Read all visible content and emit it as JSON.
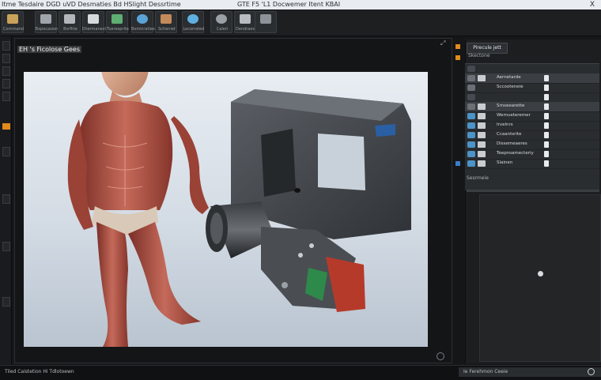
{
  "titlebar": {
    "text_left": "Itme Tesdaire DGD uVD Desmaties Bd HSlight Dessrtime",
    "text_right": "GTE F5 'L1 Docwemer Itent KBAI",
    "close": "X"
  },
  "toolbar": {
    "buttons": [
      {
        "label": "Cornmand",
        "color": "#c9a25a"
      },
      {
        "label": "Bxpocasion",
        "color": "#9fa5aa"
      },
      {
        "label": "Bsrfitie",
        "color": "#b2b7bb"
      },
      {
        "label": "Dhermanest",
        "color": "#5fae72"
      },
      {
        "label": "Tueresprite",
        "color": "#5aa3d6"
      },
      {
        "label": "Bxmicratiee",
        "color": "#c48a5a"
      },
      {
        "label": "Scheniet",
        "color": "#5fb0e0"
      },
      {
        "label": "Lecorrated",
        "color": "#9aa0a5"
      },
      {
        "label": "Caleri",
        "color": "#b8bcc0"
      },
      {
        "label": "Dendraest",
        "color": "#8d9398"
      }
    ]
  },
  "viewport": {
    "header": "EH 's Ficolose Gees",
    "corner_icon": "expand-icon"
  },
  "panel": {
    "tab": "Pirecule jett",
    "subtab": "Skectone"
  },
  "outliner": {
    "rows": [
      {
        "label": "",
        "icon_color": "#444a50"
      },
      {
        "label": "Aernetarde",
        "icon_color": "#6a7076"
      },
      {
        "label": "Sccooteneie",
        "icon_color": "#6a7076"
      },
      {
        "label": "",
        "icon_color": "#444a50"
      },
      {
        "label": "Srnseearette",
        "icon_color": "#6a7076"
      },
      {
        "label": "Wemueteremer",
        "icon_color": "#4c93c9"
      },
      {
        "label": "Irvelnrs",
        "icon_color": "#4c93c9"
      },
      {
        "label": "Ccaantsrite",
        "icon_color": "#4c93c9"
      },
      {
        "label": "Dissemeaeres",
        "icon_color": "#4c93c9"
      },
      {
        "label": "Teepnsamecteriy",
        "icon_color": "#4c93c9"
      },
      {
        "label": "Slainen",
        "icon_color": "#4c93c9"
      }
    ],
    "footer": "Sesrmeie"
  },
  "statusbar": {
    "left": "Tiled Caistetion Hi Tdlotoewn",
    "right": "Ie Ferehmon Ceeie"
  }
}
